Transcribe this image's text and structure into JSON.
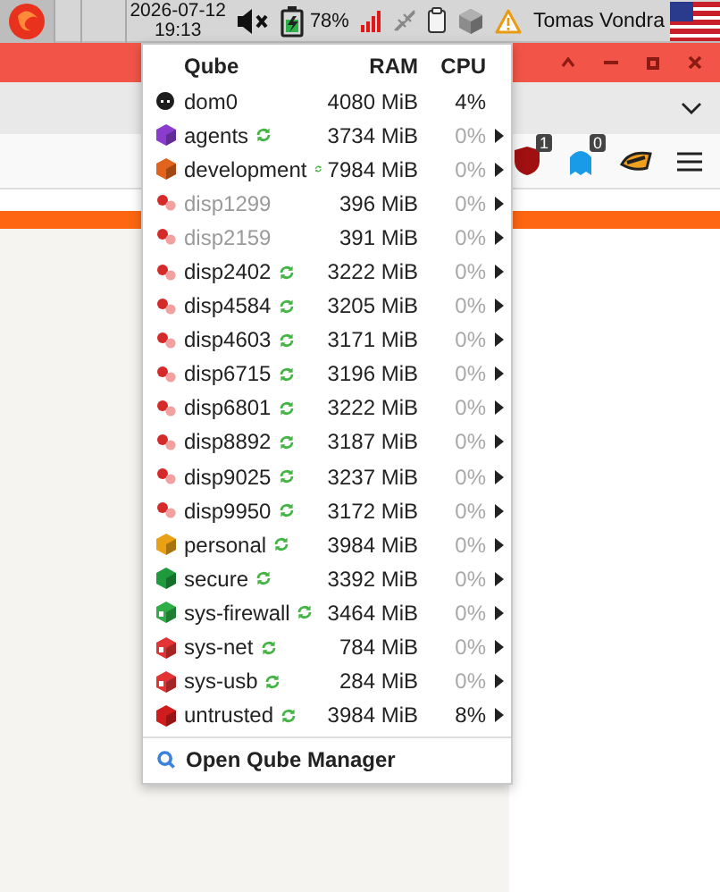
{
  "taskbar": {
    "date": "2026-07-12",
    "time": "19:13",
    "audio_muted": true,
    "battery": "78%",
    "user": "Tomas Vondra"
  },
  "browser": {
    "badges": [
      "1",
      "0"
    ]
  },
  "menu": {
    "columns": [
      "Qube",
      "RAM",
      "CPU"
    ],
    "rows": [
      {
        "name": "dom0",
        "kind": "dom0",
        "color": "#1e1e1e",
        "updates": false,
        "ram": "4080 MiB",
        "cpu": "4%",
        "busy": true,
        "dimmed": false,
        "submenu": false
      },
      {
        "name": "agents",
        "kind": "cube",
        "color": "#8a3ccf",
        "updates": true,
        "ram": "3734 MiB",
        "cpu": "0%",
        "busy": false,
        "dimmed": false,
        "submenu": true
      },
      {
        "name": "development",
        "kind": "cube",
        "color": "#e2641c",
        "updates": true,
        "ram": "7984 MiB",
        "cpu": "0%",
        "busy": false,
        "dimmed": false,
        "submenu": true
      },
      {
        "name": "disp1299",
        "kind": "disp",
        "color": "#d42a2a",
        "updates": false,
        "ram": "396 MiB",
        "cpu": "0%",
        "busy": false,
        "dimmed": true,
        "submenu": true
      },
      {
        "name": "disp2159",
        "kind": "disp",
        "color": "#d42a2a",
        "updates": false,
        "ram": "391 MiB",
        "cpu": "0%",
        "busy": false,
        "dimmed": true,
        "submenu": true
      },
      {
        "name": "disp2402",
        "kind": "disp",
        "color": "#d42a2a",
        "updates": true,
        "ram": "3222 MiB",
        "cpu": "0%",
        "busy": false,
        "dimmed": false,
        "submenu": true
      },
      {
        "name": "disp4584",
        "kind": "disp",
        "color": "#d42a2a",
        "updates": true,
        "ram": "3205 MiB",
        "cpu": "0%",
        "busy": false,
        "dimmed": false,
        "submenu": true
      },
      {
        "name": "disp4603",
        "kind": "disp",
        "color": "#d42a2a",
        "updates": true,
        "ram": "3171 MiB",
        "cpu": "0%",
        "busy": false,
        "dimmed": false,
        "submenu": true
      },
      {
        "name": "disp6715",
        "kind": "disp",
        "color": "#d42a2a",
        "updates": true,
        "ram": "3196 MiB",
        "cpu": "0%",
        "busy": false,
        "dimmed": false,
        "submenu": true
      },
      {
        "name": "disp6801",
        "kind": "disp",
        "color": "#d42a2a",
        "updates": true,
        "ram": "3222 MiB",
        "cpu": "0%",
        "busy": false,
        "dimmed": false,
        "submenu": true
      },
      {
        "name": "disp8892",
        "kind": "disp",
        "color": "#d42a2a",
        "updates": true,
        "ram": "3187 MiB",
        "cpu": "0%",
        "busy": false,
        "dimmed": false,
        "submenu": true
      },
      {
        "name": "disp9025",
        "kind": "disp",
        "color": "#d42a2a",
        "updates": true,
        "ram": "3237 MiB",
        "cpu": "0%",
        "busy": false,
        "dimmed": false,
        "submenu": true
      },
      {
        "name": "disp9950",
        "kind": "disp",
        "color": "#d42a2a",
        "updates": true,
        "ram": "3172 MiB",
        "cpu": "0%",
        "busy": false,
        "dimmed": false,
        "submenu": true
      },
      {
        "name": "personal",
        "kind": "cube",
        "color": "#e8a014",
        "updates": true,
        "ram": "3984 MiB",
        "cpu": "0%",
        "busy": false,
        "dimmed": false,
        "submenu": true
      },
      {
        "name": "secure",
        "kind": "cube",
        "color": "#1f9a3c",
        "updates": true,
        "ram": "3392 MiB",
        "cpu": "0%",
        "busy": false,
        "dimmed": false,
        "submenu": true
      },
      {
        "name": "sys-firewall",
        "kind": "service",
        "color": "#2fae47",
        "updates": true,
        "ram": "3464 MiB",
        "cpu": "0%",
        "busy": false,
        "dimmed": false,
        "submenu": true
      },
      {
        "name": "sys-net",
        "kind": "service",
        "color": "#e23434",
        "updates": true,
        "ram": "784 MiB",
        "cpu": "0%",
        "busy": false,
        "dimmed": false,
        "submenu": true
      },
      {
        "name": "sys-usb",
        "kind": "service",
        "color": "#e23434",
        "updates": true,
        "ram": "284 MiB",
        "cpu": "0%",
        "busy": false,
        "dimmed": false,
        "submenu": true
      },
      {
        "name": "untrusted",
        "kind": "cube",
        "color": "#d01c1c",
        "updates": true,
        "ram": "3984 MiB",
        "cpu": "8%",
        "busy": true,
        "dimmed": false,
        "submenu": true
      }
    ],
    "footer": "Open Qube Manager"
  }
}
